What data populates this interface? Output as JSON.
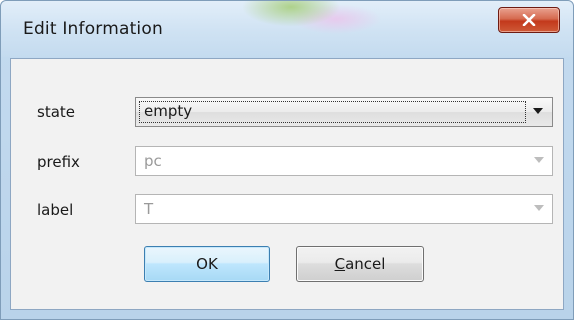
{
  "window": {
    "title": "Edit Information",
    "close_glyph": "x"
  },
  "form": {
    "fields": [
      {
        "label": "state",
        "value": "empty",
        "enabled": true
      },
      {
        "label": "prefix",
        "value": "pc",
        "enabled": false
      },
      {
        "label": "label",
        "value": "T",
        "enabled": false
      }
    ]
  },
  "buttons": {
    "ok_label": "OK",
    "cancel_label": "Cancel"
  },
  "colors": {
    "close_button": "#c3391c",
    "ok_button_border": "#3c7fb1",
    "disabled_text": "#9a9a9a"
  }
}
